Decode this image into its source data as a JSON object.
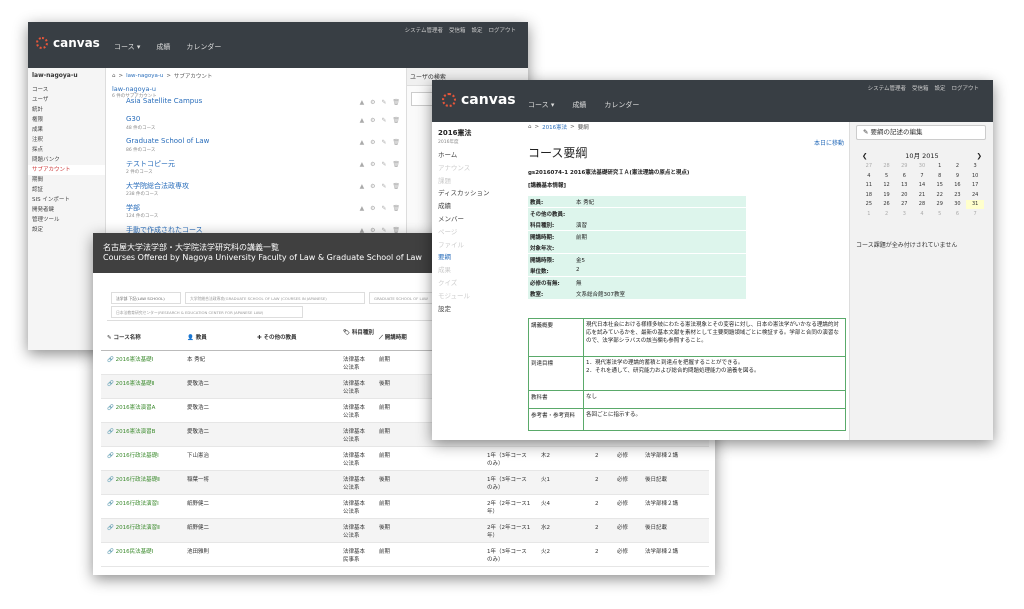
{
  "w1": {
    "logo": "canvas",
    "nav": [
      "コース ▾",
      "成績",
      "カレンダー"
    ],
    "util": [
      "システム管理者",
      "受信箱",
      "設定",
      "ログアウト"
    ],
    "account": "law-nagoya-u",
    "sidebar": [
      "コース",
      "ユーザ",
      "統計",
      "権限",
      "成果",
      "注釈",
      "採点",
      "問題バンク",
      "サブアカウント",
      "期間",
      "認証",
      "SIS インポート",
      "開発者鍵",
      "管理ツール",
      "設定"
    ],
    "breadcrumb": {
      "root_icon": "⌂",
      "sep": ">",
      "link": "law-nagoya-u",
      "current": "サブアカウント"
    },
    "head": {
      "title": "law-nagoya-u",
      "sub": "6 件のサブアカウント"
    },
    "subaccounts": [
      {
        "name": "Asia Satellite Campus",
        "count": ""
      },
      {
        "name": "G30",
        "count": "48 件のコース"
      },
      {
        "name": "Graduate School of Law",
        "count": "86 件のコース"
      },
      {
        "name": "テストコピー元",
        "count": "2 件のコース"
      },
      {
        "name": "大学院総合法政専攻",
        "count": "238 件のコース"
      },
      {
        "name": "学部",
        "count": "124 件のコース"
      },
      {
        "name": "手動で作成されたコース",
        "count": ""
      }
    ],
    "icons": "▲ ⚙ ✎ 🗑",
    "right": {
      "title": "ユーザの検索"
    }
  },
  "w3": {
    "title": "名古屋大学法学部・大学院法学研究科の講義一覧",
    "subtitle": "Courses Offered by Nagoya University Faculty of Law & Graduate School of Law",
    "tabs": [
      "法学部 下記(LAW SCHOOL)",
      "大学院総合法政専攻(GRADUATE SCHOOL OF LAW (COURSES IN JAPANESE)",
      "GRADUATE SCHOOL OF LAW",
      "日本法教育研究センター(RESEARCH & EDUCATION CENTER FOR JAPANESE LAW)"
    ],
    "headers": {
      "name": "コース名称",
      "teacher": "教員",
      "other": "その他の教員",
      "type": "科目種別",
      "period": "開講時期"
    },
    "rows": [
      {
        "name": "2016憲法基礎Ⅰ",
        "teacher": "本 秀紀",
        "type": "法律基本\n公法系",
        "period": "前期",
        "year": "",
        "dow": "",
        "credit": "",
        "req": "",
        "dept": ""
      },
      {
        "name": "2016憲法基礎Ⅱ",
        "teacher": "愛敬浩二",
        "type": "法律基本\n公法系",
        "period": "後期",
        "year": "",
        "dow": "",
        "credit": "",
        "req": "",
        "dept": ""
      },
      {
        "name": "2016憲法演習A",
        "teacher": "愛敬浩二",
        "type": "法律基本\n公法系",
        "period": "前期",
        "year": "",
        "dow": "",
        "credit": "",
        "req": "",
        "dept": ""
      },
      {
        "name": "2016憲法演習B",
        "teacher": "愛敬浩二",
        "type": "法律基本\n公法系",
        "period": "前期",
        "year": "",
        "dow": "",
        "credit": "",
        "req": "",
        "dept": ""
      },
      {
        "name": "2016行政法基礎Ⅰ",
        "teacher": "下山憲治",
        "type": "法律基本\n公法系",
        "period": "前期",
        "year": "1年（3年コース\nのみ）",
        "dow": "木2",
        "credit": "2",
        "req": "必修",
        "dept": "法学部棟２講"
      },
      {
        "name": "2016行政法基礎Ⅱ",
        "teacher": "稲葉一将",
        "type": "法律基本\n公法系",
        "period": "後期",
        "year": "1年（3年コース\nのみ）",
        "dow": "火1",
        "credit": "2",
        "req": "必修",
        "dept": "後日記載"
      },
      {
        "name": "2016行政法演習Ⅰ",
        "teacher": "紙野健二",
        "type": "法律基本\n公法系",
        "period": "前期",
        "year": "2年（2年コース1\n年）",
        "dow": "火4",
        "credit": "2",
        "req": "必修",
        "dept": "法学部棟２講"
      },
      {
        "name": "2016行政法演習Ⅱ",
        "teacher": "紙野健二",
        "type": "法律基本\n公法系",
        "period": "後期",
        "year": "2年（2年コース1\n年）",
        "dow": "水2",
        "credit": "2",
        "req": "必修",
        "dept": "後日記載"
      },
      {
        "name": "2016民法基礎Ⅰ",
        "teacher": "池田雅則",
        "type": "法律基本\n民事系",
        "period": "前期",
        "year": "1年（3年コース\nのみ）",
        "dow": "火2",
        "credit": "2",
        "req": "必修",
        "dept": "法学部棟２講"
      }
    ]
  },
  "w2": {
    "logo": "canvas",
    "nav": [
      "コース ▾",
      "成績",
      "カレンダー"
    ],
    "util": [
      "システム管理者",
      "受信箱",
      "設定",
      "ログアウト"
    ],
    "course": "2016憲法",
    "term": "2016年度",
    "sidebar": [
      {
        "label": "ホーム",
        "state": ""
      },
      {
        "label": "アナウンス",
        "state": "dim"
      },
      {
        "label": "課題",
        "state": "dim"
      },
      {
        "label": "ディスカッション",
        "state": ""
      },
      {
        "label": "成績",
        "state": ""
      },
      {
        "label": "メンバー",
        "state": ""
      },
      {
        "label": "ページ",
        "state": "dim"
      },
      {
        "label": "ファイル",
        "state": "dim"
      },
      {
        "label": "要綱",
        "state": "act"
      },
      {
        "label": "成果",
        "state": "dim"
      },
      {
        "label": "クイズ",
        "state": "dim"
      },
      {
        "label": "モジュール",
        "state": "dim"
      },
      {
        "label": "設定",
        "state": ""
      }
    ],
    "breadcrumb": {
      "root_icon": "⌂",
      "sep": ">",
      "link": "2016憲法",
      "current": "要綱"
    },
    "goto_today": "本日に移動",
    "syllabus_title": "コース要綱",
    "course_code": "gs2016074-1 2016憲法基礎研究ＩＡ(憲法理論の原点と現点)",
    "basic_info": "[講義基本情報]",
    "info": [
      {
        "k": "教員:",
        "v": "本 秀紀"
      },
      {
        "k": "その他の教員:",
        "v": ""
      },
      {
        "k": "科目種別:",
        "v": "演習"
      },
      {
        "k": "開講時期:",
        "v": "前期"
      },
      {
        "k": "対象年次:",
        "v": ""
      },
      {
        "k": "開講時限:",
        "v": "金5"
      },
      {
        "k": "単位数:",
        "v": "2"
      },
      {
        "k": "必修の有無:",
        "v": "無"
      },
      {
        "k": "教室:",
        "v": "文系総合館307教室"
      }
    ],
    "desc": [
      {
        "k": "講義概要",
        "v": "現代日本社会における様様多岐にわたる憲法現象とその変容に対し、日本の憲法学がいかなる理論的対応を試みているかを、最新の基本文献を素材として主要問題領域ごとに検証する。学部と合同の演習なので、法学部シラバスの該当欄も参照すること。"
      },
      {
        "k": "到達目標",
        "v": "1．現代憲法学の理論的蓄積と到達点を把握することができる。\n2．それを通して、研究能力および総合的問題処理能力の涵養を図る。"
      },
      {
        "k": "教科書",
        "v": "なし"
      },
      {
        "k": "参考書・参考資料",
        "v": "各回ごとに指示する。"
      }
    ],
    "edit_button": "要綱の記述の編集",
    "calendar": {
      "month": "10月 2015",
      "prev": "❮",
      "next": "❯",
      "days": [
        [
          "27",
          "dim"
        ],
        [
          "28",
          "dim"
        ],
        [
          "29",
          "dim"
        ],
        [
          "30",
          "dim"
        ],
        [
          "1",
          ""
        ],
        [
          "2",
          ""
        ],
        [
          "3",
          ""
        ],
        [
          "4",
          ""
        ],
        [
          "5",
          ""
        ],
        [
          "6",
          ""
        ],
        [
          "7",
          ""
        ],
        [
          "8",
          ""
        ],
        [
          "9",
          ""
        ],
        [
          "10",
          ""
        ],
        [
          "11",
          ""
        ],
        [
          "12",
          ""
        ],
        [
          "13",
          ""
        ],
        [
          "14",
          ""
        ],
        [
          "15",
          ""
        ],
        [
          "16",
          ""
        ],
        [
          "17",
          ""
        ],
        [
          "18",
          ""
        ],
        [
          "19",
          ""
        ],
        [
          "20",
          ""
        ],
        [
          "21",
          ""
        ],
        [
          "22",
          ""
        ],
        [
          "23",
          ""
        ],
        [
          "24",
          ""
        ],
        [
          "25",
          ""
        ],
        [
          "26",
          ""
        ],
        [
          "27",
          ""
        ],
        [
          "28",
          ""
        ],
        [
          "29",
          ""
        ],
        [
          "30",
          ""
        ],
        [
          "31",
          "today"
        ],
        [
          "1",
          "dim"
        ],
        [
          "2",
          "dim"
        ],
        [
          "3",
          "dim"
        ],
        [
          "4",
          "dim"
        ],
        [
          "5",
          "dim"
        ],
        [
          "6",
          "dim"
        ],
        [
          "7",
          "dim"
        ]
      ]
    },
    "no_due": "コース課題が全み付けされていません"
  },
  "colors": {
    "topbar": "#383e44",
    "accent": "#e8563a",
    "link": "#2a6ebb",
    "green": "#3a8a2c",
    "mint": "#ddf5ec"
  }
}
